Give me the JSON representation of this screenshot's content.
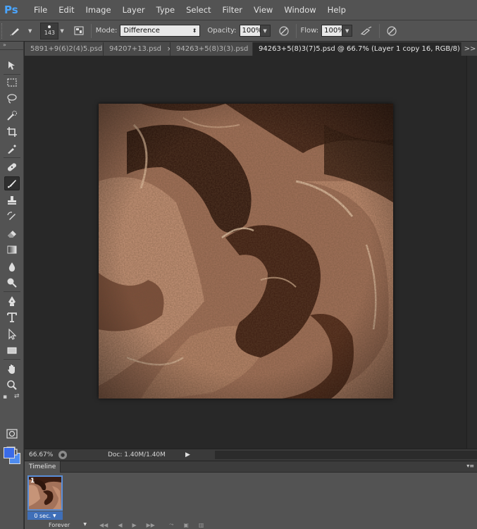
{
  "app": {
    "logo": "Ps"
  },
  "menu": [
    "File",
    "Edit",
    "Image",
    "Layer",
    "Type",
    "Select",
    "Filter",
    "View",
    "Window",
    "Help"
  ],
  "options": {
    "brush_size": "143",
    "mode_label": "Mode:",
    "mode_value": "Difference",
    "opacity_label": "Opacity:",
    "opacity_value": "100%",
    "flow_label": "Flow:",
    "flow_value": "100%"
  },
  "tabs": [
    {
      "label": "5891+9(6)2(4)5.psd",
      "close": "×"
    },
    {
      "label": "94207+13.psd",
      "close": "×"
    },
    {
      "label": "94263+5(8)3(3).psd",
      "close": "×"
    },
    {
      "label": "94263+5(8)3(7)5.psd @ 66.7% (Layer 1 copy 16, RGB/8)",
      "close": "×"
    }
  ],
  "tab_overflow": ">>",
  "status": {
    "zoom": "66.67%",
    "doc": "Doc: 1.40M/1.40M"
  },
  "timeline": {
    "title": "Timeline",
    "frame_number": "1",
    "frame_delay": "0 sec.",
    "loop": "Forever"
  },
  "colors": {
    "foreground": "#3a6be8",
    "background": "#4e8cf0",
    "accent": "#4aa5ff"
  },
  "icons": {
    "toolbox": [
      "move-icon",
      "marquee-icon",
      "lasso-icon",
      "quick-select-icon",
      "crop-icon",
      "eyedropper-icon",
      "healing-icon",
      "brush-icon",
      "stamp-icon",
      "history-brush-icon",
      "eraser-icon",
      "gradient-icon",
      "blur-icon",
      "dodge-icon",
      "pen-icon",
      "type-icon",
      "path-select-icon",
      "shape-icon",
      "hand-icon",
      "zoom-icon"
    ]
  }
}
